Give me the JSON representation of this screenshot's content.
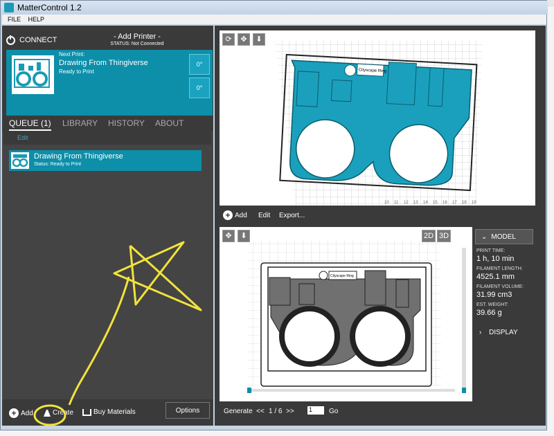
{
  "window": {
    "title": "MatterControl 1.2"
  },
  "menu": {
    "items": [
      "FILE",
      "HELP"
    ]
  },
  "printer": {
    "connect_label": "CONNECT",
    "name": "- Add Printer -",
    "status": "STATUS: Not Connected"
  },
  "next_print": {
    "label": "Next Print:",
    "name": "Drawing From Thingiverse",
    "status": "Ready to Print",
    "rot1": "0°",
    "rot2": "0°"
  },
  "tabs": [
    "QUEUE (1)",
    "LIBRARY",
    "HISTORY",
    "ABOUT"
  ],
  "queue": {
    "edit_label": "Edit",
    "item_name": "Drawing From Thingiverse",
    "item_status": "Status: Ready to Print"
  },
  "bottom": {
    "add": "Add",
    "create": "Create",
    "buy": "Buy Materials",
    "options": "Options"
  },
  "view3d_toolbar": {
    "add": "Add",
    "edit": "Edit",
    "export": "Export..."
  },
  "view2d": {
    "mode_2d": "2D",
    "mode_3d": "3D"
  },
  "model_stats": {
    "header": "MODEL",
    "print_time_label": "PRINT TIME:",
    "print_time": "1 h, 10 min",
    "filament_length_label": "FILAMENT LENGTH:",
    "filament_length": "4525.1 mm",
    "filament_volume_label": "FILAMENT VOLUME:",
    "filament_volume": "31.99 cm3",
    "weight_label": "EST. WEIGHT:",
    "weight": "39.66 g",
    "display": "DISPLAY"
  },
  "model_label": "Cityscape Ring",
  "gen_bar": {
    "generate": "Generate",
    "prev": "<<",
    "layer": "1 / 6",
    "next": ">>",
    "layer_input": "1",
    "go": "Go"
  },
  "colors": {
    "accent": "#0d8ea9",
    "panel": "#444444",
    "annotation": "#f2e33a"
  }
}
